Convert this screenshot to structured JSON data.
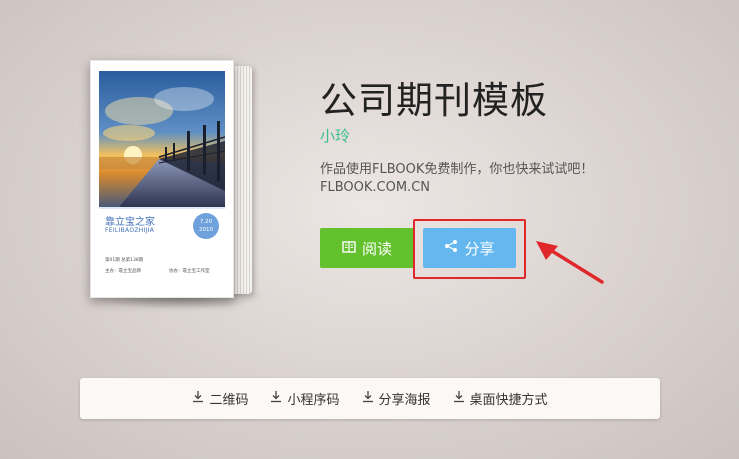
{
  "book": {
    "cover_title": "靠立宝之家",
    "cover_subtitle": "FEILIBAOZHIJIA",
    "cover_date": "7.20",
    "cover_year": "2010",
    "cover_line1": "第01期 总第138期",
    "cover_line2": "主办：靠立宝品牌",
    "cover_line3": "协办：靠立宝工作室"
  },
  "title": "公司期刊模板",
  "author": "小玲",
  "description_line1": "作品使用FLBOOK免费制作，你也快来试试吧！",
  "description_line2": "FLBOOK.COM.CN",
  "buttons": {
    "read": "阅读",
    "share": "分享"
  },
  "bottom_bar": [
    {
      "label": "二维码",
      "icon": "download-icon"
    },
    {
      "label": "小程序码",
      "icon": "download-icon"
    },
    {
      "label": "分享海报",
      "icon": "download-icon"
    },
    {
      "label": "桌面快捷方式",
      "icon": "download-icon"
    }
  ],
  "colors": {
    "read_button": "#62c12c",
    "share_button": "#64b8ef",
    "author": "#3bbf8f",
    "highlight": "#e0282a"
  }
}
